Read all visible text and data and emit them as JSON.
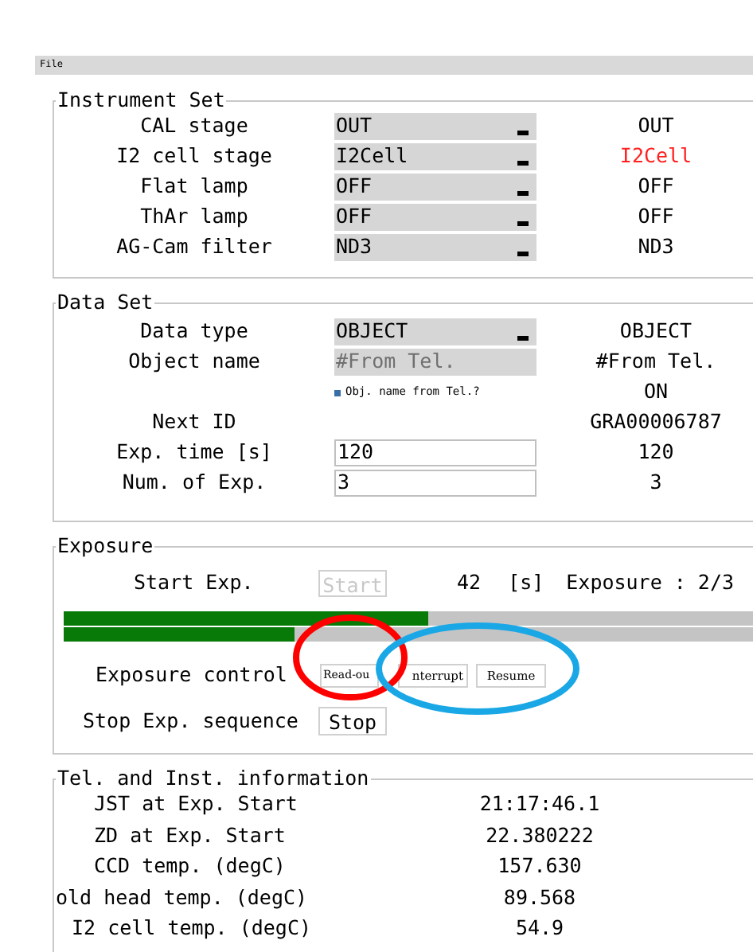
{
  "menu": [
    "File"
  ],
  "instrument_set": {
    "title": "Instrument Set",
    "rows": [
      {
        "label": "CAL stage",
        "selection": "OUT",
        "status": "OUT",
        "alert": false
      },
      {
        "label": "I2 cell stage",
        "selection": "I2Cell",
        "status": "I2Cell",
        "alert": true
      },
      {
        "label": "Flat lamp",
        "selection": "OFF",
        "status": "OFF",
        "alert": false
      },
      {
        "label": "ThAr lamp",
        "selection": "OFF",
        "status": "OFF",
        "alert": false
      },
      {
        "label": "AG-Cam filter",
        "selection": "ND3",
        "status": "ND3",
        "alert": false
      }
    ]
  },
  "data_set": {
    "title": "Data Set",
    "rows": [
      {
        "kind": "dropdown",
        "label": "Data type",
        "value": "OBJECT",
        "status": "OBJECT"
      },
      {
        "kind": "field",
        "label": "Object name",
        "value": "#From Tel.",
        "disabled": true,
        "status": "#From Tel."
      },
      {
        "kind": "checkbox",
        "label": "Obj. name from Tel.?",
        "checked": true,
        "status": "ON"
      },
      {
        "kind": "plain",
        "label": "Next ID",
        "status": "GRA00006787"
      },
      {
        "kind": "field",
        "label": "Exp. time [s]",
        "value": "120",
        "disabled": false,
        "status": "120"
      },
      {
        "kind": "field",
        "label": "Num. of Exp.",
        "value": "3",
        "disabled": false,
        "status": "3"
      }
    ]
  },
  "exposure": {
    "title": "Exposure",
    "start_label": "Start Exp.",
    "start_button": {
      "label": "Start",
      "disabled": true
    },
    "remaining": "42",
    "unit": "[s]",
    "counter": "Exposure : 2/3",
    "progress": [
      {
        "level": 0.52
      },
      {
        "level": 0.33
      }
    ],
    "control_label": "Exposure control",
    "control_buttons": [
      "Read-ou",
      "nterrupt",
      "Resume"
    ],
    "stop_label": "Stop Exp. sequence",
    "stop_button": "Stop"
  },
  "tel_info": {
    "title": "Tel. and Inst. information",
    "rows": [
      {
        "label": "JST at Exp. Start",
        "value": "21:17:46.1"
      },
      {
        "label": "ZD at Exp. Start",
        "value": "22.380222"
      },
      {
        "label": "CCD temp. (degC)",
        "value": "157.630"
      },
      {
        "label": "old head temp. (degC)",
        "value": "89.568"
      },
      {
        "label": "I2 cell temp. (degC)",
        "value": "54.9"
      }
    ]
  },
  "annotations": [
    {
      "kind": "ellipse",
      "color": "#ff0000"
    },
    {
      "kind": "ellipse",
      "color": "#1aa7e6"
    }
  ]
}
